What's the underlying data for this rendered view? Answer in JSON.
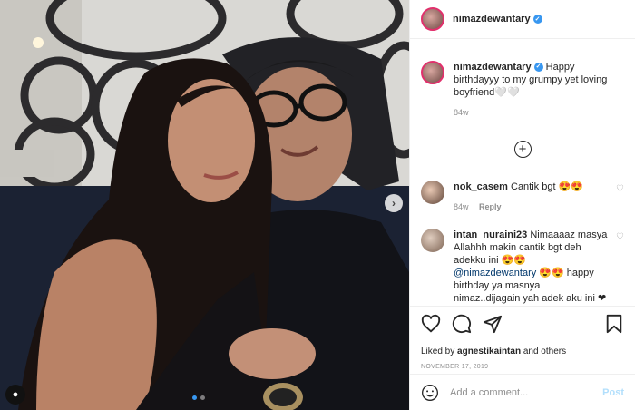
{
  "post": {
    "username": "nimazdewantary",
    "caption": "Happy birthdayyy to my grumpy yet loving boyfriend",
    "caption_emoji": "🤍🤍",
    "age": "84w",
    "more_comments_icon": "plus-circle-icon"
  },
  "comments": [
    {
      "username": "nok_casem",
      "text": "Cantik bgt",
      "emoji": "😍😍",
      "age": "84w",
      "reply_label": "Reply"
    },
    {
      "username": "intan_nuraini23",
      "text_start": "Nimaaaaz masya Allahhh makin cantik bgt deh adekku ini",
      "mention": "@nimazdewantary",
      "text_end": "happy birthday ya masnya nimaz..dijagain yah adek aku ini",
      "emoji": "😍😍",
      "emoji_end": "❤"
    }
  ],
  "likes": {
    "prefix": "Liked by",
    "user": "agnestikaintan",
    "suffix": "and others"
  },
  "date": "NOVEMBER 17, 2019",
  "add_comment": {
    "placeholder": "Add a comment...",
    "post_label": "Post"
  },
  "colors": {
    "accent": "#3897f0",
    "post_disabled": "#b2dffc",
    "muted": "#8e8e8e"
  }
}
